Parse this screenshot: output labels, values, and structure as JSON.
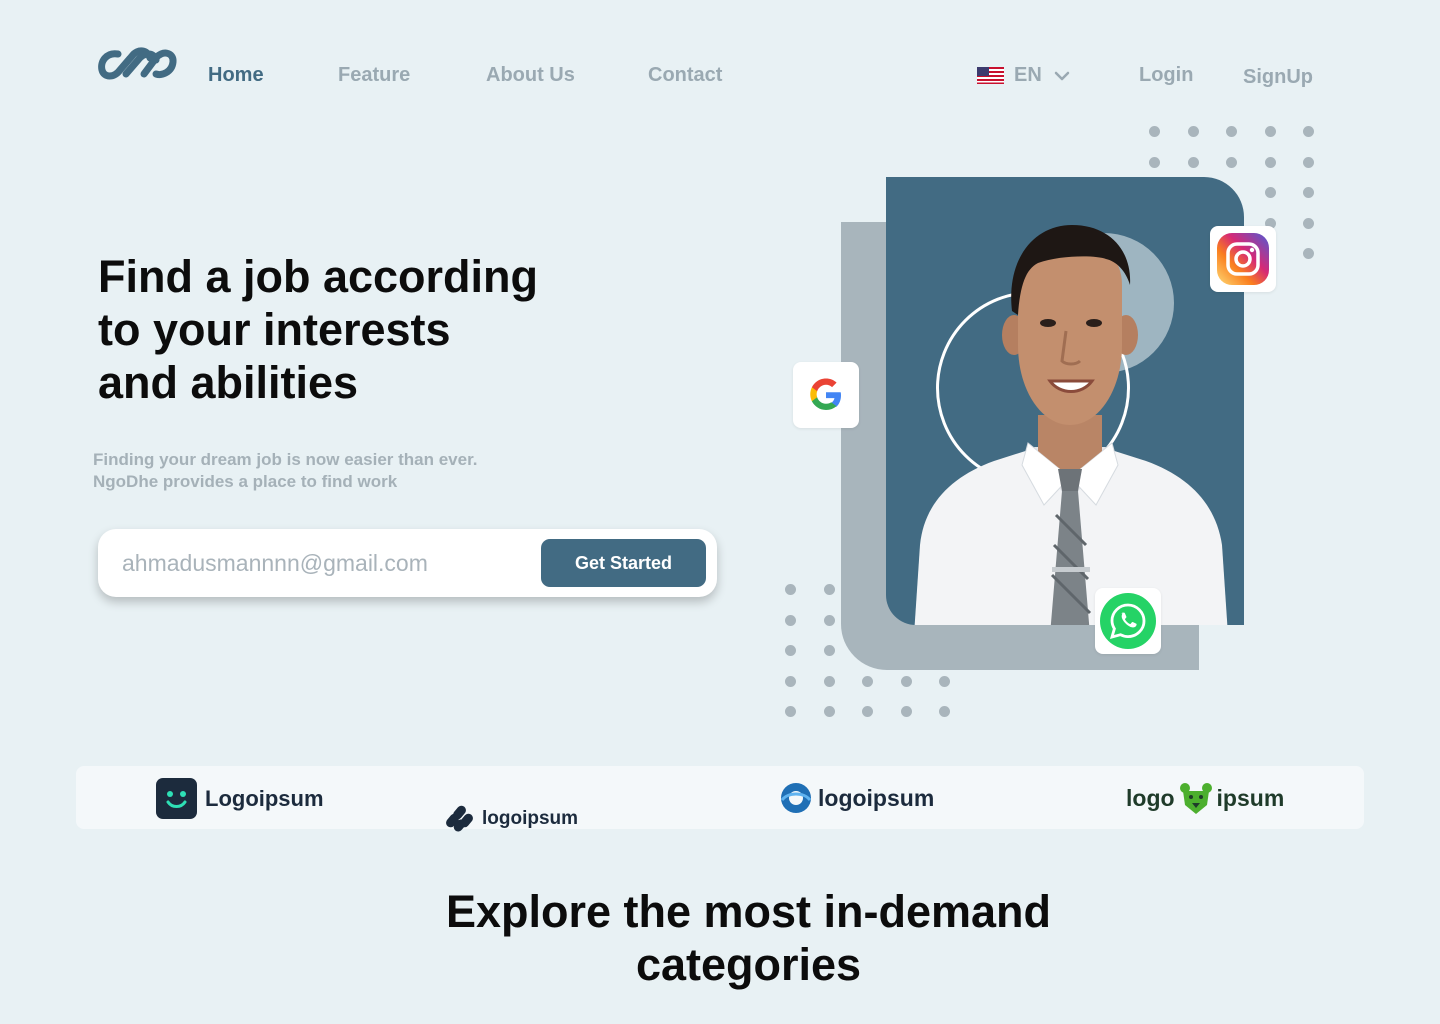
{
  "nav": {
    "links": [
      {
        "label": "Home",
        "active": true
      },
      {
        "label": "Feature",
        "active": false
      },
      {
        "label": "About Us",
        "active": false
      },
      {
        "label": "Contact",
        "active": false
      }
    ],
    "language": "EN",
    "login_label": "Login",
    "signup_label": "SignUp"
  },
  "hero": {
    "headline_lines": [
      "Find a job according",
      "to your interests",
      "and abilities"
    ],
    "subtext_lines": [
      "Finding your dream job is now easier than ever.",
      "NgoDhe provides a place to find work"
    ],
    "email": {
      "value": "",
      "placeholder": "ahmadusmannnn@gmail.com"
    },
    "cta_label": "Get Started",
    "badges": [
      "google-icon",
      "instagram-icon",
      "whatsapp-icon"
    ]
  },
  "partners": [
    "Logoipsum",
    "logoipsum",
    "logoipsum",
    "logo",
    "ipsum"
  ],
  "section": {
    "title_lines": [
      "Explore the most in-demand",
      "categories"
    ]
  },
  "colors": {
    "background": "#e8f1f4",
    "primary": "#426b83",
    "muted": "#9aa9b2",
    "card_back": "#a8b5bc",
    "strip": "#f4f8fa"
  }
}
